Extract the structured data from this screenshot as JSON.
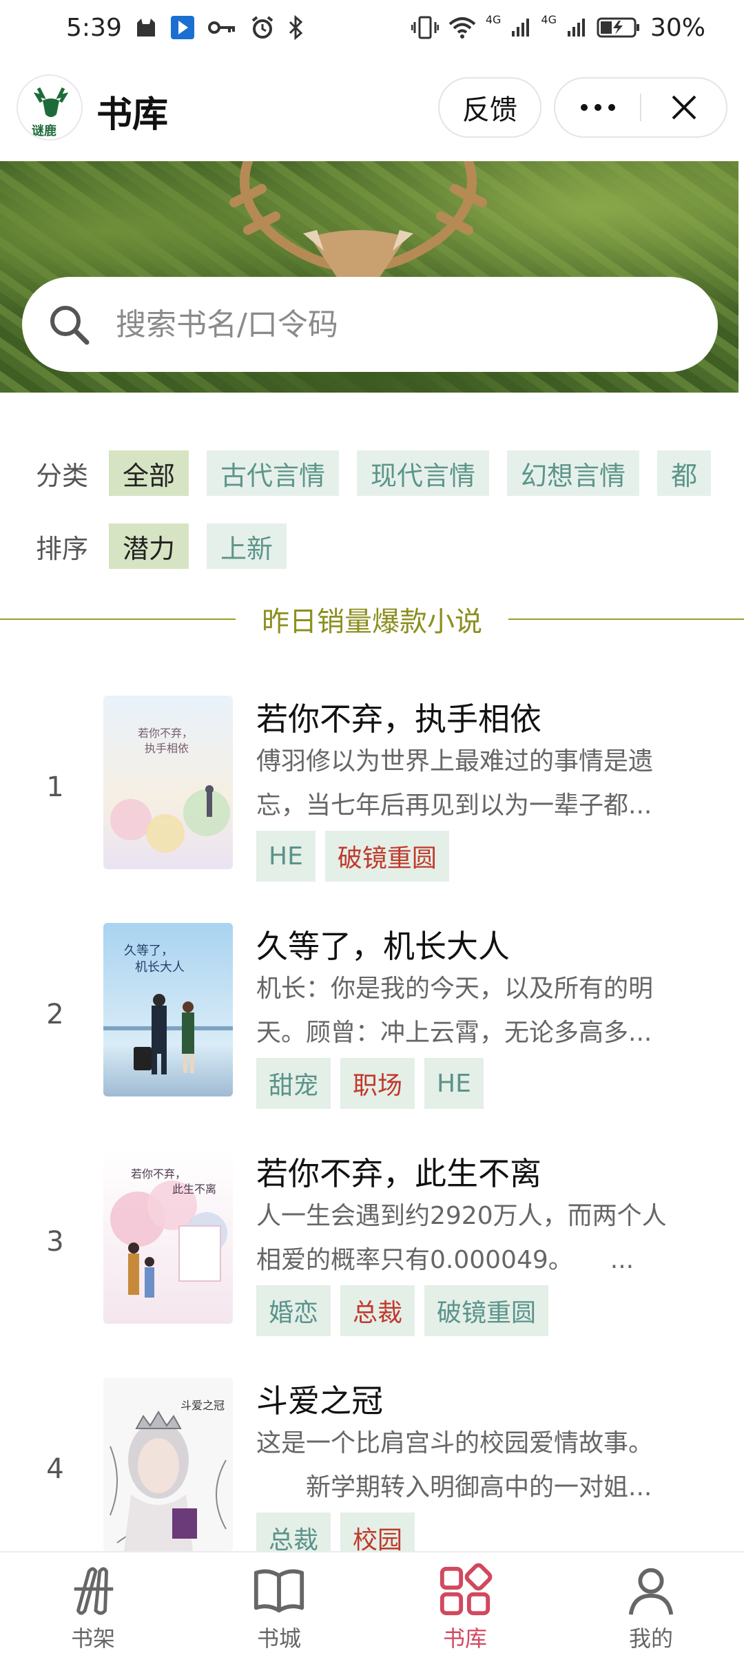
{
  "status_bar": {
    "time": "5:39",
    "network_1": "4G",
    "network_2": "4G",
    "battery": "30%"
  },
  "header": {
    "logo_text": "谜鹿",
    "title": "书库",
    "feedback_label": "反馈",
    "more_icon": "more-icon",
    "close_icon": "close-icon"
  },
  "search": {
    "placeholder": "搜索书名/口令码"
  },
  "filters": {
    "category_label": "分类",
    "categories": [
      "全部",
      "古代言情",
      "现代言情",
      "幻想言情",
      "都"
    ],
    "sort_label": "排序",
    "sorts": [
      "潜力",
      "上新"
    ]
  },
  "section_title": "昨日销量爆款小说",
  "books": [
    {
      "rank": "1",
      "title": "若你不弃，执手相依",
      "desc_line1": "傅羽修以为世界上最难过的事情是遗",
      "desc_line2": "忘，当七年后再见到以为一辈子都...",
      "cover_text": "若你不弃，执手相依",
      "tags": [
        {
          "text": "HE",
          "red": false
        },
        {
          "text": "破镜重圆",
          "red": true
        }
      ]
    },
    {
      "rank": "2",
      "title": "久等了，机长大人",
      "desc_line1": "机长：你是我的今天，以及所有的明",
      "desc_line2": "天。顾曾：冲上云霄，无论多高多...",
      "cover_text": "久等了，机长大人",
      "tags": [
        {
          "text": "甜宠",
          "red": false
        },
        {
          "text": "职场",
          "red": true
        },
        {
          "text": "HE",
          "red": false
        }
      ]
    },
    {
      "rank": "3",
      "title": "若你不弃，此生不离",
      "desc_line1": "人一生会遇到约2920万人，而两个人",
      "desc_line2": "相爱的概率只有0.000049。　　...",
      "cover_text": "若你不弃，此生不离",
      "tags": [
        {
          "text": "婚恋",
          "red": false
        },
        {
          "text": "总裁",
          "red": true
        },
        {
          "text": "破镜重圆",
          "red": false
        }
      ]
    },
    {
      "rank": "4",
      "title": "斗爱之冠",
      "desc_line1": "这是一个比肩宫斗的校园爱情故事。",
      "desc_line2": "　　新学期转入明御高中的一对姐...",
      "cover_text": "斗爱之冠",
      "tags": [
        {
          "text": "总裁",
          "red": false
        },
        {
          "text": "校园",
          "red": true
        }
      ]
    }
  ],
  "bottom_nav": [
    {
      "label": "书架",
      "icon": "bookshelf-icon",
      "active": false
    },
    {
      "label": "书城",
      "icon": "open-book-icon",
      "active": false
    },
    {
      "label": "书库",
      "icon": "library-grid-icon",
      "active": true
    },
    {
      "label": "我的",
      "icon": "profile-icon",
      "active": false
    }
  ],
  "colors": {
    "accent_red": "#d2485e",
    "tag_bg": "#e4efe8",
    "tag_teal": "#5a938a",
    "tag_red": "#c0392b",
    "section_olive": "#8c8f1f",
    "chip_active_bg": "#d6e4c3"
  }
}
